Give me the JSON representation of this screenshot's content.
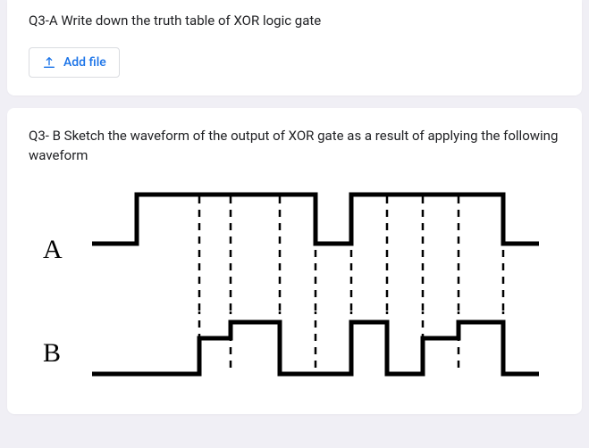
{
  "q3a": {
    "text": "Q3-A Write down the truth table of XOR logic gate",
    "add_file_label": "Add file"
  },
  "q3b": {
    "text": "Q3- B Sketch the waveform of the output of XOR gate as a result of applying the following waveform",
    "labelA": "A",
    "labelB": "B"
  },
  "chart_data": {
    "type": "timing-diagram",
    "title": "XOR input waveforms",
    "signals": [
      {
        "name": "A",
        "transitions_x": [
          110,
          180,
          310,
          350,
          430,
          520
        ],
        "initial_level": "low"
      },
      {
        "name": "B",
        "transitions_x": [
          180,
          215,
          270,
          350,
          390,
          430,
          470,
          520
        ],
        "initial_level": "low"
      }
    ],
    "dashed_guides_x": [
      180,
      215,
      270,
      310,
      350,
      390,
      430,
      470,
      520
    ],
    "x_range": [
      60,
      560
    ]
  }
}
